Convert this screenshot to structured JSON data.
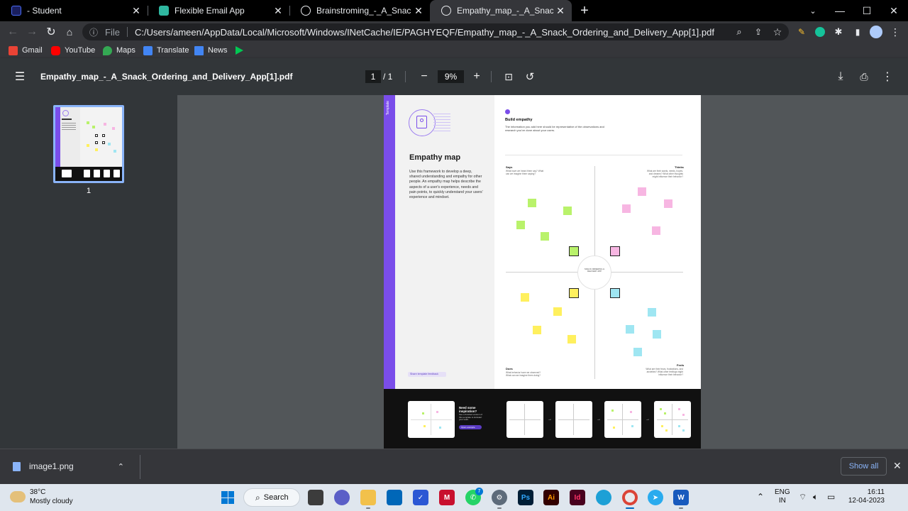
{
  "tabs": [
    {
      "title": "- Student",
      "active": false
    },
    {
      "title": "Flexible Email App",
      "active": false
    },
    {
      "title": "Brainstroming_-_A_Snack_Orderi",
      "active": false
    },
    {
      "title": "Empathy_map_-_A_Snack_Orderi",
      "active": true
    }
  ],
  "toolbar": {
    "scheme": "File",
    "url": "C:/Users/ameen/AppData/Local/Microsoft/Windows/INetCache/IE/PAGHYEQF/Empathy_map_-_A_Snack_Ordering_and_Delivery_App[1].pdf"
  },
  "bookmarks": [
    "Gmail",
    "YouTube",
    "Maps",
    "Translate",
    "News"
  ],
  "pdf": {
    "filename": "Empathy_map_-_A_Snack_Ordering_and_Delivery_App[1].pdf",
    "current_page": "1",
    "page_total": "/ 1",
    "zoom": "9%",
    "thumbnail_number": "1"
  },
  "document": {
    "tag": "Template",
    "title": "Empathy map",
    "description": "Use this framework to develop a deep, shared understanding and empathy for other people. An empathy map helps describe the aspects of a user's experience, needs and pain points, to quickly understand your users' experience and mindset.",
    "feedback": "Share template feedback",
    "build_heading": "Build empathy",
    "build_text": "The information you add here should be representative of the observations and research you've done about your users.",
    "says": "Says",
    "says_sub": "What have we heard them say? What can we imagine them saying?",
    "thinks": "Thinks",
    "thinks_sub": "What are their wants, needs, hopes, and dreams? What other thoughts might influence their behavior?",
    "does": "Does",
    "does_sub": "What behavior have we observed? What can we imagine them doing?",
    "feels": "Feels",
    "feels_sub": "What are their fears, frustrations, and anxieties? What other feelings might influence their behavior?",
    "center": "SNACK ORDERING & DELIVERY APP",
    "need_more": "Need some inspiration?",
    "need_more_sub": "See a finished version of this template to kickstart your work.",
    "open_example": "Open example"
  },
  "downloads": {
    "file": "image1.png",
    "show_all": "Show all"
  },
  "taskbar": {
    "temperature": "38°C",
    "condition": "Mostly cloudy",
    "search": "Search",
    "whatsapp_badge": "7",
    "lang": "ENG",
    "region": "IN",
    "time": "16:11",
    "date": "12-04-2023"
  },
  "colors": {
    "accent_purple": "#7a4dea",
    "sticky_green": "#b9f26b",
    "sticky_pink": "#f7b6e2",
    "sticky_yellow": "#fff05e",
    "sticky_blue": "#9fe6f2",
    "link_blue": "#8ab4f8"
  }
}
